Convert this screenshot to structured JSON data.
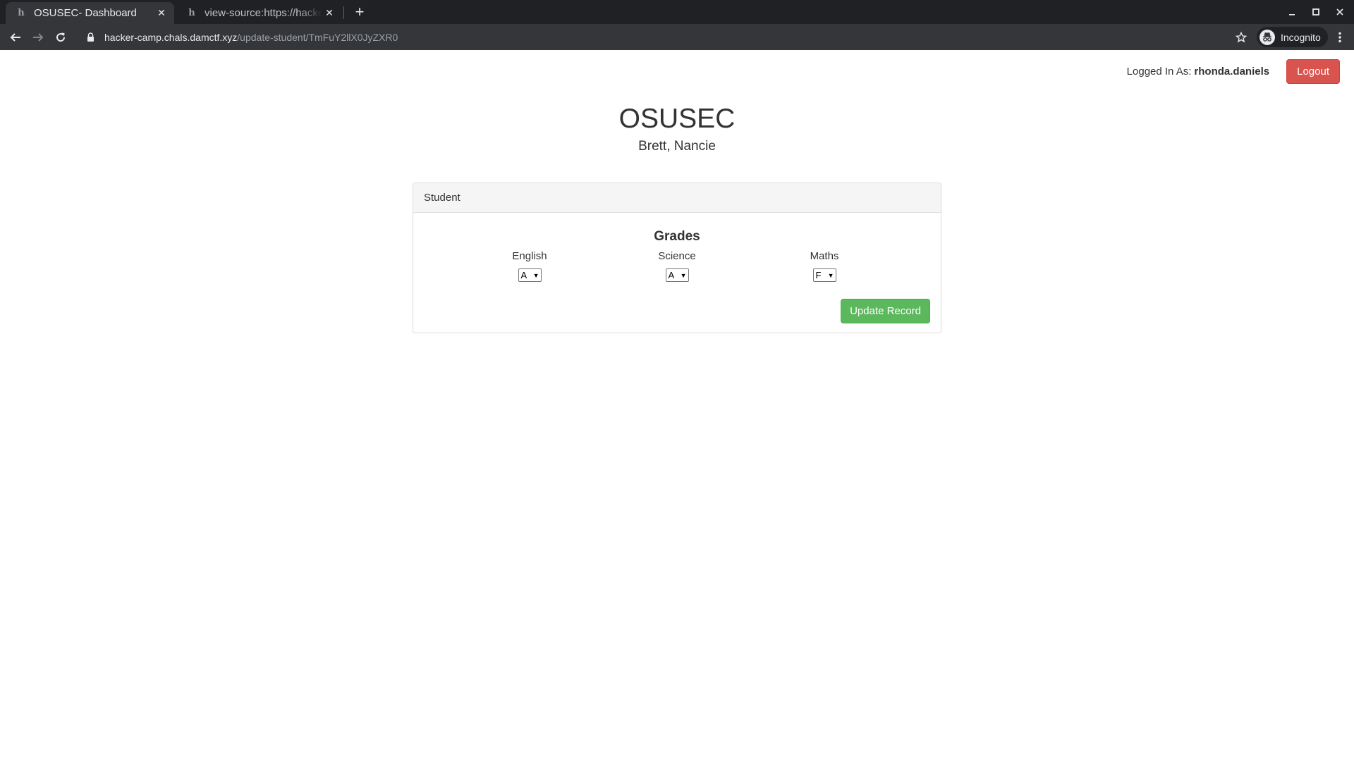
{
  "browser": {
    "tabs": [
      {
        "title": "OSUSEC- Dashboard",
        "favicon": "h",
        "active": true
      },
      {
        "title": "view-source:https://hacker-camp.chals.damctf.xyz",
        "favicon": "h",
        "active": false
      }
    ],
    "url_host": "hacker-camp.chals.damctf.xyz",
    "url_path": "/update-student/TmFuY2llX0JyZXR0",
    "incognito_label": "Incognito",
    "icons": {
      "close": "close-icon",
      "new_tab": "plus-icon",
      "back": "back-arrow-icon",
      "forward": "forward-arrow-icon",
      "reload": "reload-icon",
      "lock": "lock-icon",
      "bookmark": "star-icon",
      "incognito": "incognito-icon",
      "menu": "kebab-menu-icon"
    }
  },
  "header": {
    "logged_in_label": "Logged In As:",
    "username": "rhonda.daniels",
    "logout_label": "Logout"
  },
  "main": {
    "title": "OSUSEC",
    "student_name": "Brett, Nancie"
  },
  "panel": {
    "heading": "Student",
    "grades_title": "Grades",
    "subjects": [
      {
        "name": "English",
        "grade": "A"
      },
      {
        "name": "Science",
        "grade": "A"
      },
      {
        "name": "Maths",
        "grade": "F"
      }
    ],
    "update_label": "Update Record"
  },
  "colors": {
    "logout_button": "#d9534f",
    "update_button": "#5cb85c",
    "chrome_dark": "#202124",
    "chrome_toolbar": "#35363a"
  }
}
